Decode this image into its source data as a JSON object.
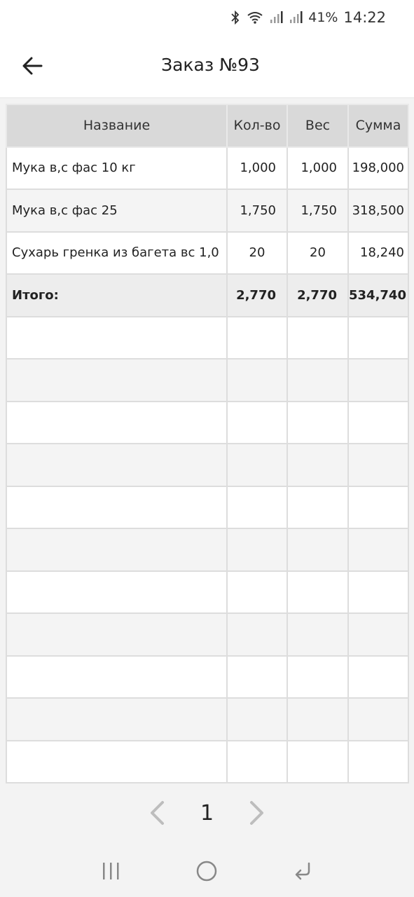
{
  "status_bar": {
    "battery": "41%",
    "time": "14:22",
    "icons": [
      "bluetooth-icon",
      "wifi-icon",
      "signal-icon",
      "signal-icon"
    ]
  },
  "app_bar": {
    "title": "Заказ №93",
    "back_icon": "arrow-left-icon"
  },
  "table": {
    "headers": [
      "Название",
      "Кол-во",
      "Вес",
      "Сумма"
    ],
    "rows": [
      [
        "Мука в,с фас 10 кг",
        "1,000",
        "1,000",
        "198,000"
      ],
      [
        "Мука в,с фас 25",
        "1,750",
        "1,750",
        "318,500"
      ],
      [
        "Сухарь гренка из багета вс 1,0",
        "20",
        "20",
        "18,240"
      ]
    ],
    "total": [
      "Итого:",
      "2,770",
      "2,770",
      "534,740"
    ],
    "empty_rows": 11
  },
  "pagination": {
    "current_page": "1",
    "prev_icon": "chevron-left-icon",
    "next_icon": "chevron-right-icon"
  },
  "nav_bar": {
    "icons": [
      "recent-apps-icon",
      "home-icon",
      "back-icon"
    ]
  }
}
